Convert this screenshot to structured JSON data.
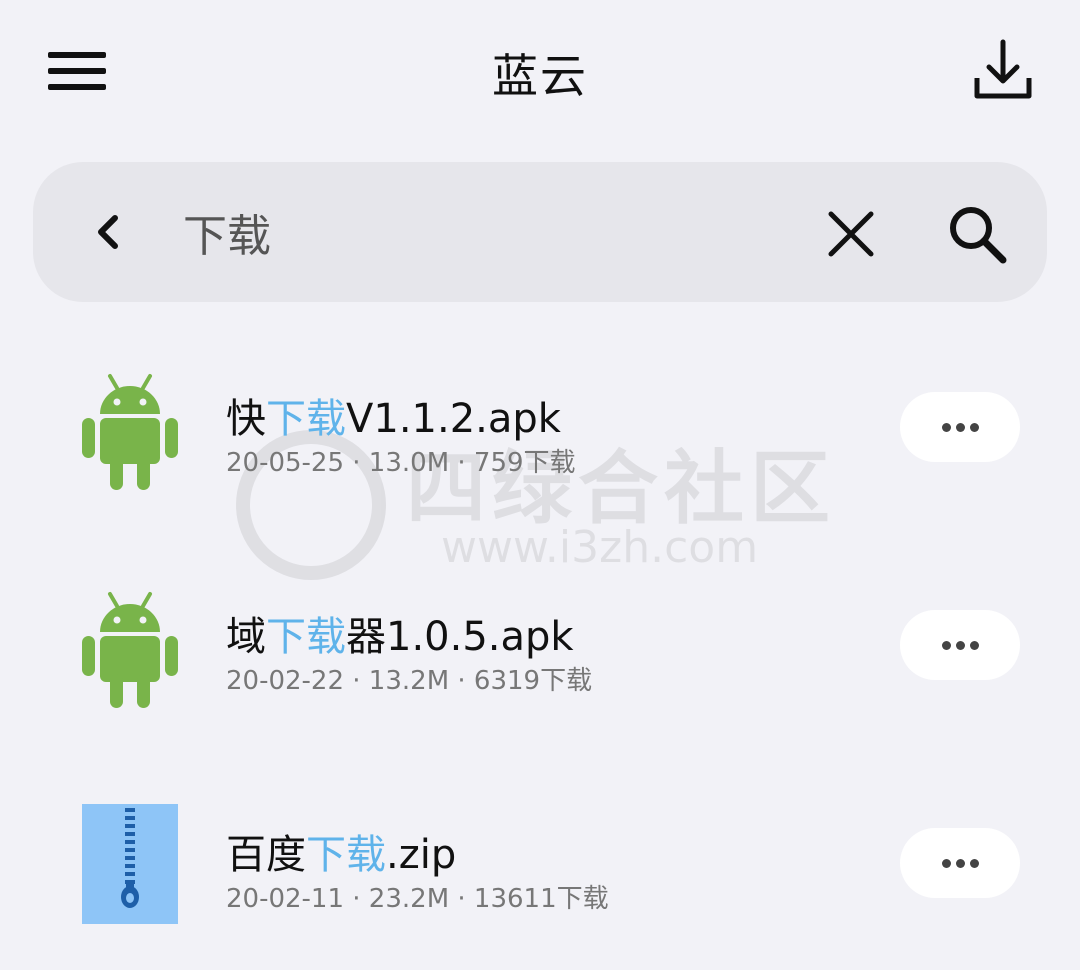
{
  "header": {
    "title": "蓝云",
    "menu_icon": "hamburger-menu-icon",
    "download_icon": "download-icon"
  },
  "search": {
    "value": "下载",
    "back_icon": "chevron-left-icon",
    "clear_icon": "close-icon",
    "search_icon": "search-icon"
  },
  "files": [
    {
      "name_prefix": "快",
      "name_highlight": "下载",
      "name_suffix": "V1.1.2.apk",
      "meta": "20-05-25 · 13.0M · 759下载",
      "icon": "android-icon"
    },
    {
      "name_prefix": "域",
      "name_highlight": "下载",
      "name_suffix": "器1.0.5.apk",
      "meta": "20-02-22 · 13.2M · 6319下载",
      "icon": "android-icon"
    },
    {
      "name_prefix": "百度",
      "name_highlight": "下载",
      "name_suffix": ".zip",
      "meta": "20-02-11 · 23.2M · 13611下载",
      "icon": "zip-archive-icon"
    }
  ],
  "watermark": {
    "name": "四绿合社区",
    "url": "www.i3zh.com"
  },
  "colors": {
    "background": "#f2f2f7",
    "search_bar": "#e6e6eb",
    "highlight": "#5fb3ea",
    "android_green": "#79b44a",
    "zip_blue": "#8ec5f7"
  }
}
